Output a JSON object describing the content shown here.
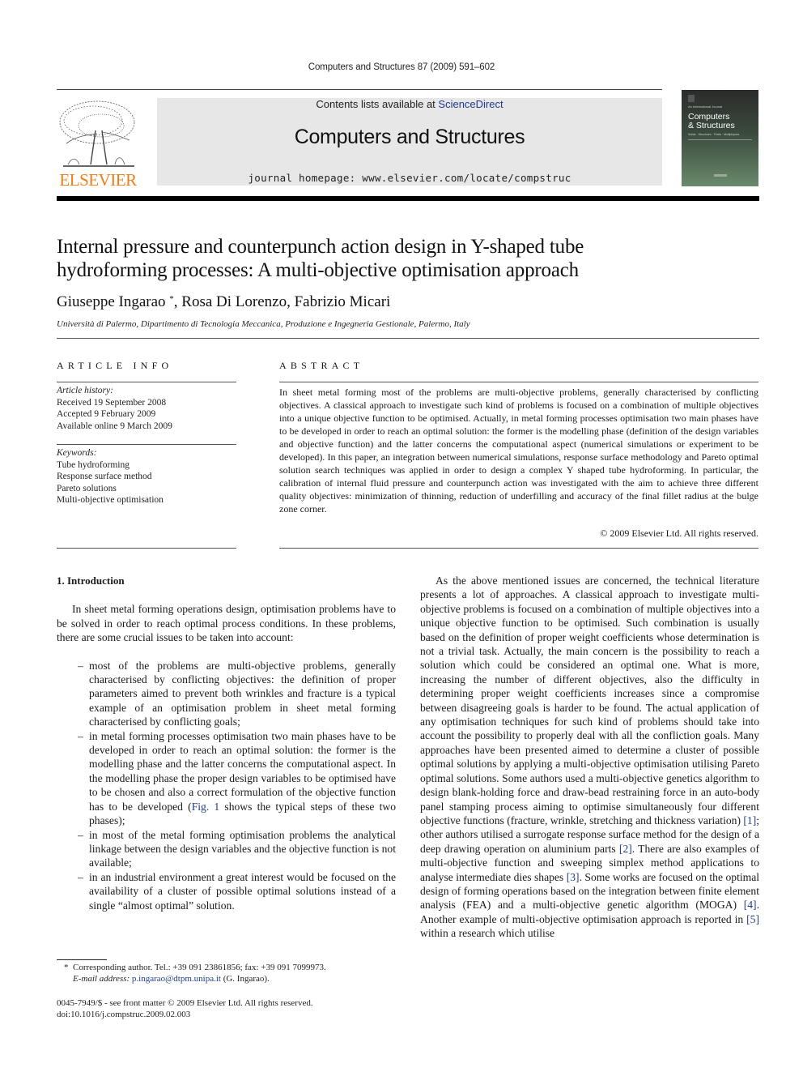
{
  "header": {
    "citation": "Computers and Structures 87 (2009) 591–602",
    "contents_prefix": "Contents lists available at ",
    "contents_link": "ScienceDirect",
    "journal_name": "Computers and Structures",
    "homepage": "journal homepage: www.elsevier.com/locate/compstruc",
    "publisher_logo_text": "ELSEVIER",
    "cover": {
      "small_line": "An International Journal",
      "title_line1": "Computers",
      "title_line2": "& Structures",
      "subtitle": "Solids · Structures · Fluids · Multiphysics"
    }
  },
  "article": {
    "title_line1": "Internal pressure and counterpunch action design in Y-shaped tube",
    "title_line2": "hydroforming processes: A multi-objective optimisation approach",
    "authors": {
      "first": "Giuseppe Ingarao",
      "first_mark": "*",
      "rest": ", Rosa Di Lorenzo, Fabrizio Micari"
    },
    "affiliation": "Università di Palermo, Dipartimento di Tecnologia Meccanica, Produzione e Ingegneria Gestionale, Palermo, Italy"
  },
  "article_info": {
    "heading": "ARTICLE INFO",
    "history_label": "Article history:",
    "history": [
      "Received 19 September 2008",
      "Accepted 9 February 2009",
      "Available online 9 March 2009"
    ],
    "keywords_label": "Keywords:",
    "keywords": [
      "Tube hydroforming",
      "Response surface method",
      "Pareto solutions",
      "Multi-objective optimisation"
    ]
  },
  "abstract": {
    "heading": "ABSTRACT",
    "text": "In sheet metal forming most of the problems are multi-objective problems, generally characterised by conflicting objectives. A classical approach to investigate such kind of problems is focused on a combination of multiple objectives into a unique objective function to be optimised. Actually, in metal forming processes optimisation two main phases have to be developed in order to reach an optimal solution: the former is the modelling phase (definition of the design variables and objective function) and the latter concerns the computational aspect (numerical simulations or experiment to be developed). In this paper, an integration between numerical simulations, response surface methodology and Pareto optimal solution search techniques was applied in order to design a complex Y shaped tube hydroforming. In particular, the calibration of internal fluid pressure and counterpunch action was investigated with the aim to achieve three different quality objectives: minimization of thinning, reduction of underfilling and accuracy of the final fillet radius at the bulge zone corner.",
    "copyright": "© 2009 Elsevier Ltd. All rights reserved."
  },
  "body": {
    "section_heading": "1. Introduction",
    "intro_paragraph": "In sheet metal forming operations design, optimisation problems have to be solved in order to reach optimal process conditions. In these problems, there are some crucial issues to be taken into account:",
    "bullet_dash": "–",
    "bullets": [
      {
        "before": "most of the problems are multi-objective problems, generally characterised by conflicting objectives: the definition of proper parameters aimed to prevent both wrinkles and fracture is a typical example of an optimisation problem in sheet metal forming characterised by conflicting goals;",
        "ref": "",
        "after": ""
      },
      {
        "before": "in metal forming processes optimisation two main phases have to be developed in order to reach an optimal solution: the former is the modelling phase and the latter concerns the computational aspect. In the modelling phase the proper design variables to be optimised have to be chosen and also a correct formulation of the objective function has to be developed (",
        "ref": "Fig. 1",
        "after": " shows the typical steps of these two phases);"
      },
      {
        "before": "in most of the metal forming optimisation problems the analytical linkage between the design variables and the objective function is not available;",
        "ref": "",
        "after": ""
      },
      {
        "before": "in an industrial environment a great interest would be focused on the availability of a cluster of possible optimal solutions instead of a single “almost optimal” solution.",
        "ref": "",
        "after": ""
      }
    ],
    "right_column": [
      {
        "text": "As the above mentioned issues are concerned, the technical literature presents a lot of approaches. A classical approach to investigate multi-objective problems is focused on a combination of multiple objectives into a unique objective function to be optimised. Such combination is usually based on the definition of proper weight coefficients whose determination is not a trivial task. Actually, the main concern is the possibility to reach a solution which could be considered an optimal one. What is more, increasing the number of different objectives, also the difficulty in determining proper weight coefficients increases since a compromise between disagreeing goals is harder to be found. The actual application of any optimisation techniques for such kind of problems should take into account the possibility to properly deal with all the confliction goals. Many approaches have been presented aimed to determine a cluster of possible optimal solutions by applying a multi-objective optimisation utilising Pareto optimal solutions. Some authors used a multi-objective genetics algorithm to design blank-holding force and draw-bead restraining force in an auto-body panel stamping process aiming to optimise simultaneously four different objective functions (fracture, wrinkle, stretching and thickness variation) ",
        "ref": "[1]"
      },
      {
        "text": "; other authors utilised a surrogate response surface method for the design of a deep drawing operation on aluminium parts ",
        "ref": "[2]"
      },
      {
        "text": ". There are also examples of multi-objective function and sweeping simplex method applications to analyse intermediate dies shapes ",
        "ref": "[3]"
      },
      {
        "text": ". Some works are focused on the optimal design of forming operations based on the integration between finite element analysis (FEA) and a multi-objective genetic algorithm (MOGA) ",
        "ref": "[4]"
      },
      {
        "text": ". Another example of multi-objective optimisation approach is reported in ",
        "ref": "[5]"
      },
      {
        "text": " within a research which utilise",
        "ref": ""
      }
    ]
  },
  "footnotes": {
    "mark": "*",
    "corresponding": "Corresponding author. Tel.: +39 091 23861856; fax: +39 091 7099973.",
    "email_label": "E-mail address:",
    "email": "p.ingarao@dtpm.unipa.it",
    "email_suffix": " (G. Ingarao).",
    "issn_line": "0045-7949/$ - see front matter © 2009 Elsevier Ltd. All rights reserved.",
    "doi": "doi:10.1016/j.compstruc.2009.02.003"
  }
}
